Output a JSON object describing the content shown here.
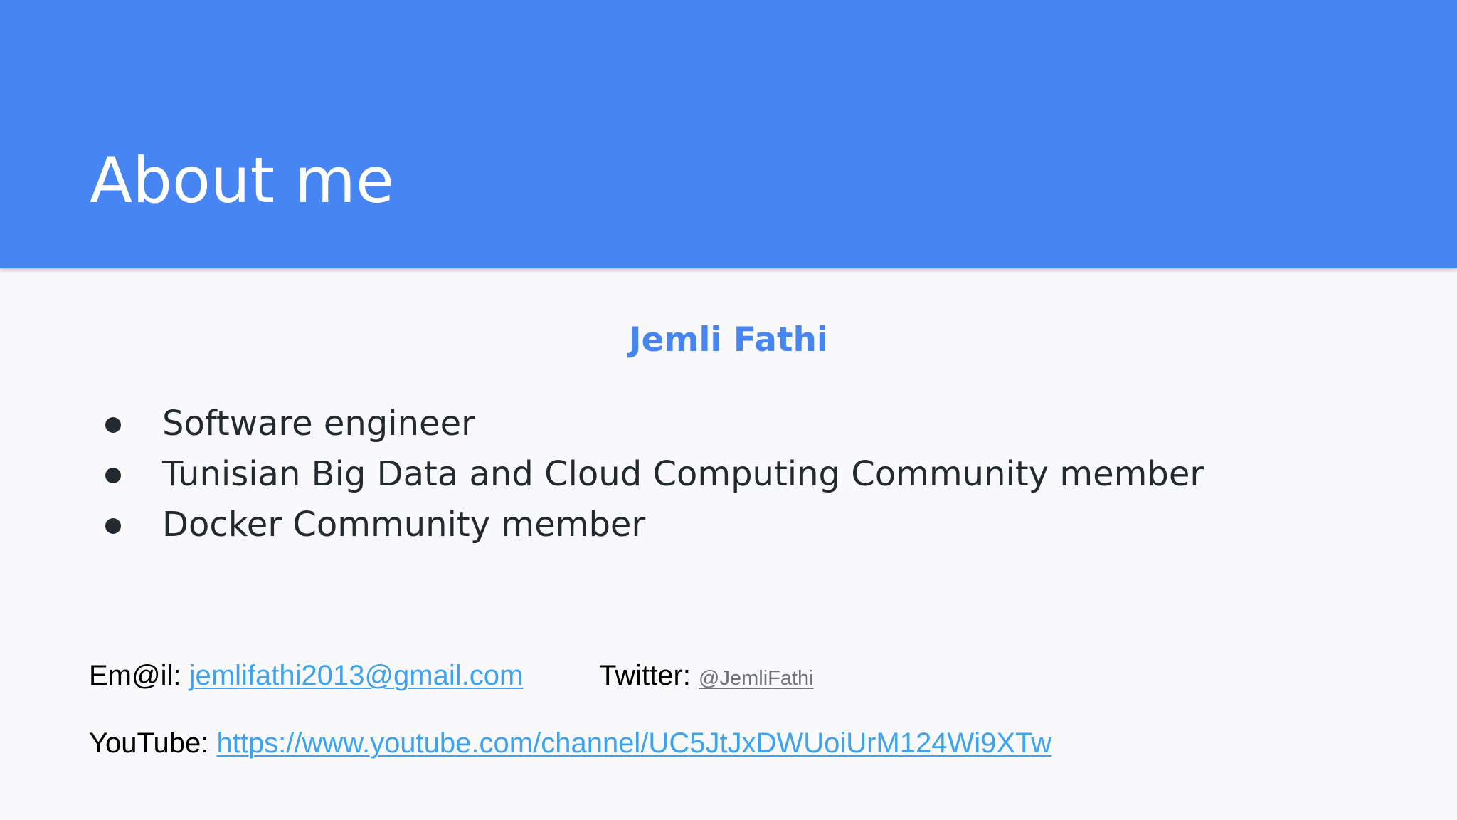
{
  "slide": {
    "title": "About me",
    "name": "Jemli Fathi",
    "bullets": [
      "Software engineer",
      "Tunisian Big Data and Cloud Computing Community member",
      "Docker Community member"
    ],
    "contacts": {
      "email_label": "Em@il:",
      "email_value": "jemlifathi2013@gmail.com",
      "twitter_label": "Twitter:",
      "twitter_value": "@JemliFathi",
      "youtube_label": "YouTube:",
      "youtube_value": "https://www.youtube.com/channel/UC5JtJxDWUoiUrM124Wi9XTw"
    },
    "colors": {
      "header_background": "#4785f2",
      "name_color": "#4785f2",
      "link_color": "#3ba3f0",
      "body_text": "#222a30",
      "slide_background": "#f9f9fb"
    }
  }
}
